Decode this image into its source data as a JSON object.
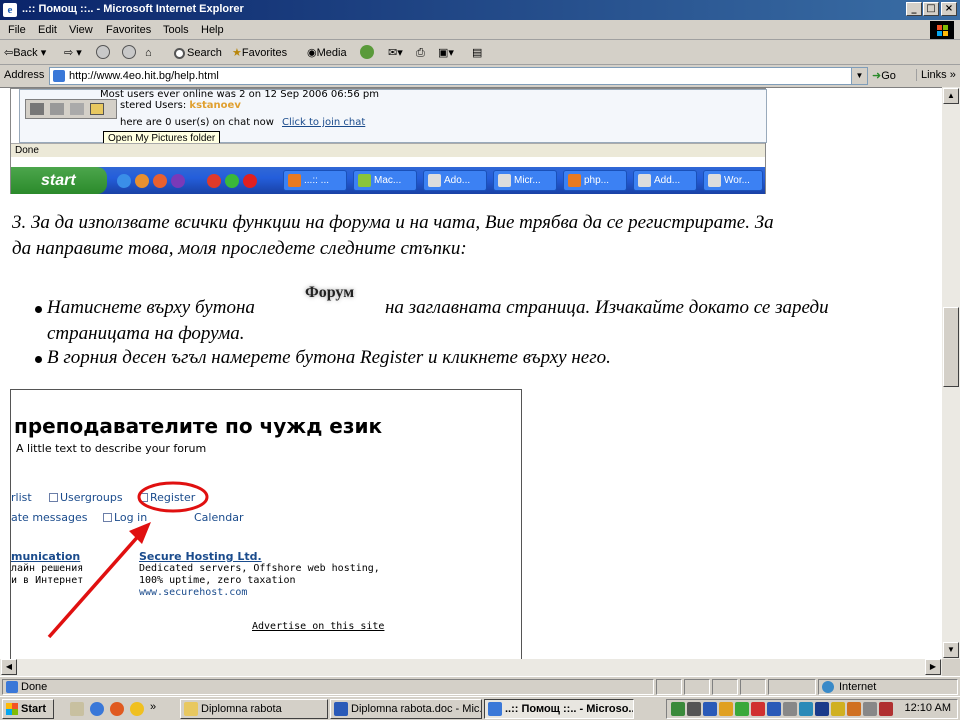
{
  "window": {
    "title": "..:: Помощ ::.. - Microsoft Internet Explorer",
    "controls": [
      "_",
      "□",
      "×"
    ]
  },
  "menu": [
    "File",
    "Edit",
    "View",
    "Favorites",
    "Tools",
    "Help"
  ],
  "toolbar": {
    "back": "Back",
    "search": "Search",
    "favorites": "Favorites",
    "media": "Media"
  },
  "address": {
    "label": "Address",
    "url": "http://www.4eo.hit.bg/help.html",
    "go": "Go",
    "links": "Links"
  },
  "shot1": {
    "line1": "Most users ever online was 2 on 12 Sep 2006 06:56 pm",
    "line2": "stered Users:",
    "line2_user": "kstanoev",
    "line3": "here are 0 user(s) on chat now",
    "chat_link": "Click to join chat",
    "tooltip": "Open My Pictures folder",
    "status": "Done",
    "start": "start",
    "tasks": [
      "...:: ...",
      "Mac...",
      "Ado...",
      "Micr...",
      "php...",
      "Add...",
      "Wor..."
    ]
  },
  "content": {
    "step3_line1": "3. За да използвате всички функции на форума и на чата, Вие трябва да се регистрирате. За",
    "step3_line2": "да направите това, моля проследете следните стъпки:",
    "bullet1_a": "Натиснете върху бутона",
    "forum_button": "Форум",
    "bullet1_b": "на заглавната страница. Изчакайте докато се зареди",
    "bullet1_c": "страницата на форума.",
    "bullet2": "В горния десен ъгъл намерете бутона Register и кликнете върху него."
  },
  "shot2": {
    "heading": "преподавателите по чужд език",
    "subtitle": "A little text to describe your forum",
    "memberlist": "rlist",
    "usergroups": "Usergroups",
    "register": "Register",
    "pm": "ate messages",
    "login": "Log in",
    "calendar": "Calendar",
    "ad1_title": "munication",
    "ad1_line1": "лайн решения",
    "ad1_line2": "и в Интернет",
    "ad2_title": "Secure Hosting Ltd.",
    "ad2_line1": "Dedicated servers, Offshore web hosting,",
    "ad2_line2": "100% uptime, zero taxation",
    "ad2_line3": "www.securehost.com",
    "advertise": "Advertise on this site",
    "highlight_color": "#e01010"
  },
  "statusbar": {
    "left": "Done",
    "zone": "Internet"
  },
  "taskbar": {
    "start": "Start",
    "tasks": [
      {
        "label": "Diplomna rabota",
        "active": false
      },
      {
        "label": "Diplomna rabota.doc - Mic...",
        "active": false
      },
      {
        "label": "..:: Помощ ::.. - Microso...",
        "active": true
      }
    ],
    "clock": "12:10 AM"
  }
}
